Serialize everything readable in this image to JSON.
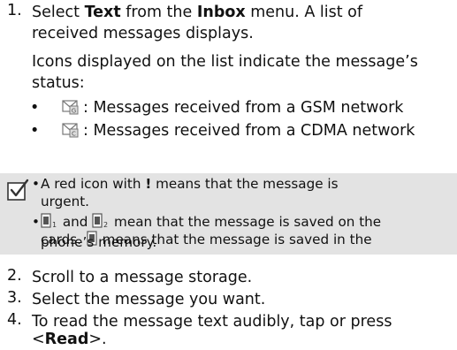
{
  "steps": [
    {
      "num": "1.",
      "pre": "Select ",
      "bold1": "Text",
      "mid": " from the ",
      "bold2": "Inbox",
      "post": " menu. A list of",
      "line2": "received messages displays."
    },
    {
      "num": "2.",
      "text": "Scroll to a message storage."
    },
    {
      "num": "3.",
      "text": "Select the message you want."
    },
    {
      "num": "4.",
      "line1": "To read the message text audibly, tap or press",
      "pre": "<",
      "bold": "Read",
      "post": ">."
    }
  ],
  "status_intro": [
    "Icons displayed on the list indicate the message’s",
    "status:"
  ],
  "status_items": [
    {
      "text": ": Messages received from a GSM network",
      "icon": "gsm-message-icon"
    },
    {
      "text": ": Messages received from a CDMA network",
      "icon": "cdma-message-icon"
    }
  ],
  "note": {
    "icon": "checkbox-note-icon",
    "item1_pre": "A red icon with ",
    "item1_bold": "!",
    "item1_post": " means that the message is",
    "item1_line2": "urgent.",
    "item2_and": " and ",
    "item2_post": " mean that the message is saved on the",
    "item2_line2a": "cards. ",
    "item2_line2b": " means that the message is saved in the",
    "item2_line3": "phone’s memory."
  },
  "colors": {
    "note_bg": "#e3e3e3"
  }
}
